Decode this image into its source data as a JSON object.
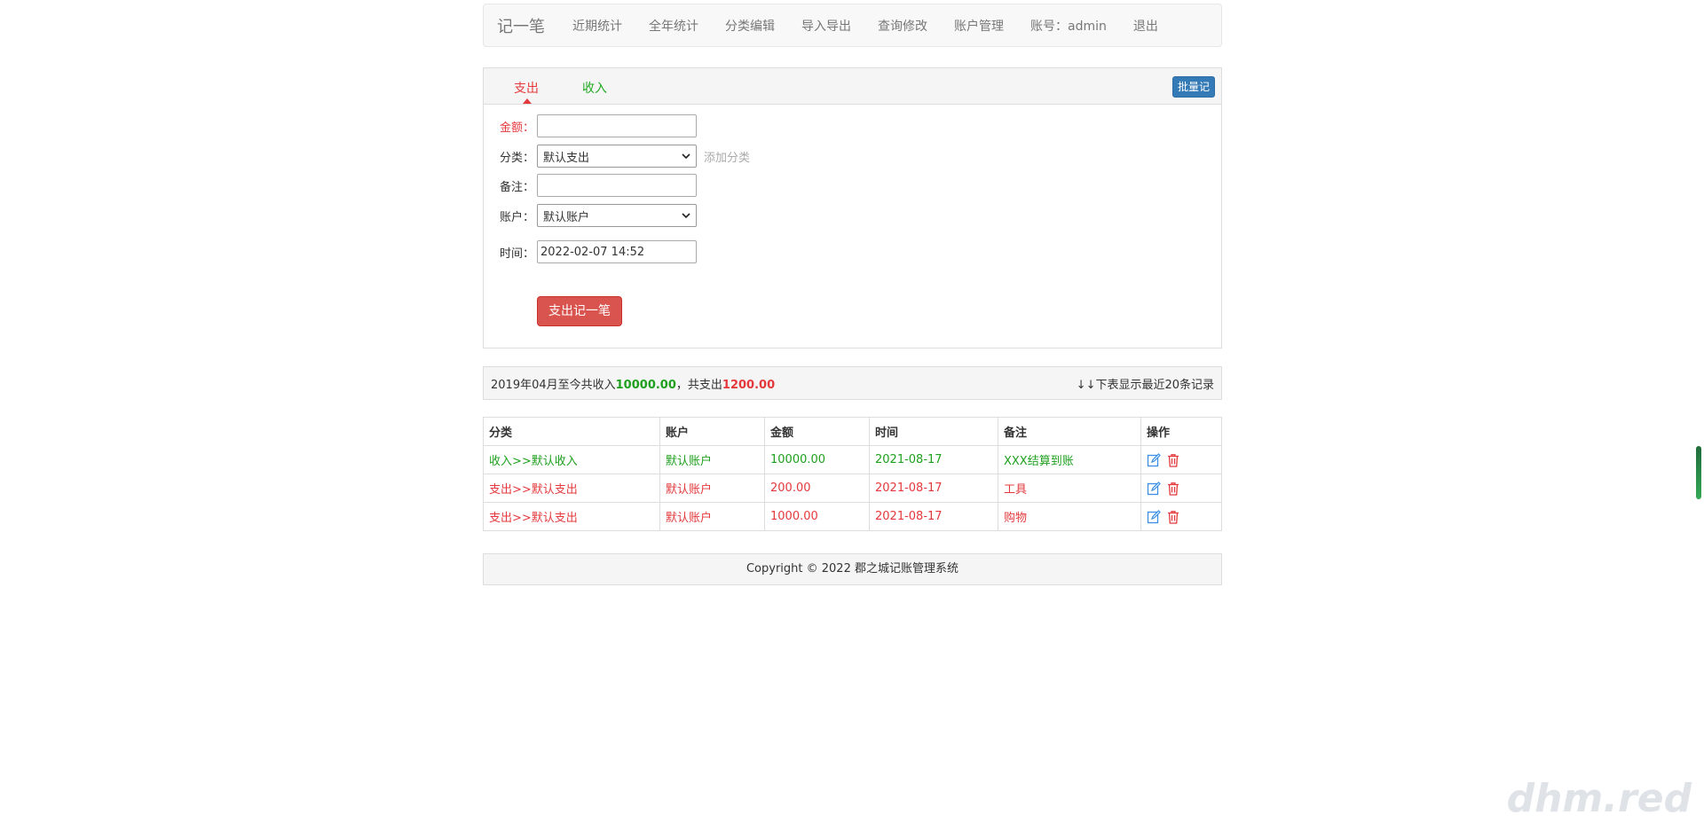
{
  "nav": {
    "brand": "记一笔",
    "items": [
      "近期统计",
      "全年统计",
      "分类编辑",
      "导入导出",
      "查询修改",
      "账户管理",
      "账号：admin",
      "退出"
    ]
  },
  "tabs": {
    "expense": "支出",
    "income": "收入",
    "batch_label": "批量记"
  },
  "form": {
    "amount_label": "金额：",
    "amount_value": "",
    "category_label": "分类：",
    "category_selected": "默认支出",
    "add_category": "添加分类",
    "note_label": "备注：",
    "note_value": "",
    "account_label": "账户：",
    "account_selected": "默认账户",
    "time_label": "时间：",
    "time_value": "2022-02-07 14:52",
    "submit_label": "支出记一笔"
  },
  "summary": {
    "prefix": "2019年04月至今共收入",
    "income_total": "10000.00",
    "middle": "，共支出",
    "expense_total": "1200.00",
    "right_note": "↓↓下表显示最近20条记录"
  },
  "table": {
    "headers": [
      "分类",
      "账户",
      "金额",
      "时间",
      "备注",
      "操作"
    ],
    "rows": [
      {
        "type": "income",
        "category": "收入>>默认收入",
        "account": "默认账户",
        "amount": "10000.00",
        "time": "2021-08-17",
        "note": "XXX结算到账"
      },
      {
        "type": "expense",
        "category": "支出>>默认支出",
        "account": "默认账户",
        "amount": "200.00",
        "time": "2021-08-17",
        "note": "工具"
      },
      {
        "type": "expense",
        "category": "支出>>默认支出",
        "account": "默认账户",
        "amount": "1000.00",
        "time": "2021-08-17",
        "note": "购物"
      }
    ]
  },
  "footer": {
    "copyright": "Copyright © 2022 郡之城记账管理系统"
  },
  "watermark": "dhm.red",
  "colors": {
    "expense": "#e4393c",
    "income": "#1ea01e",
    "primary": "#337ab7",
    "danger": "#d9534f"
  }
}
